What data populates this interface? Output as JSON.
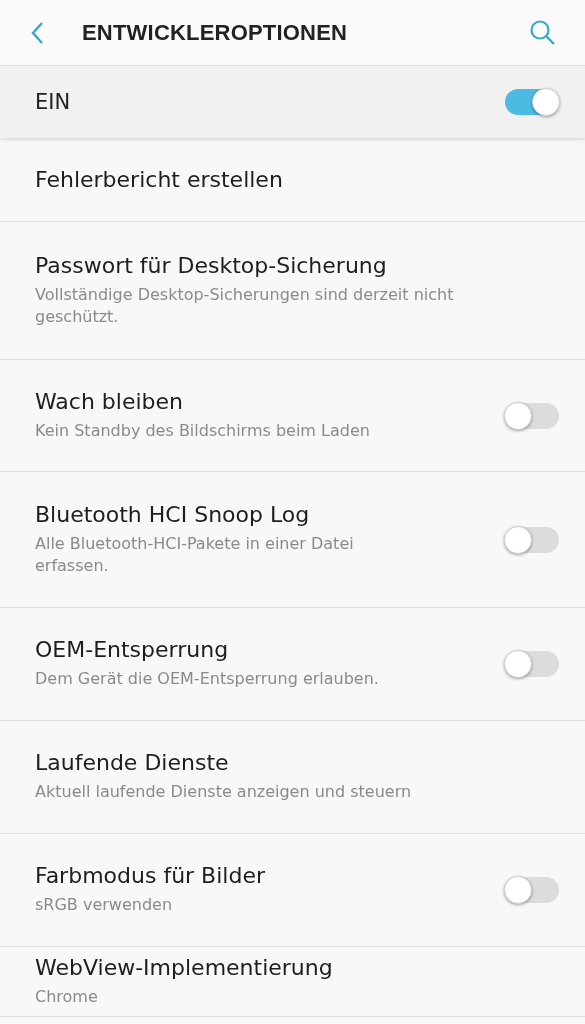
{
  "header": {
    "title": "ENTWICKLEROPTIONEN"
  },
  "master": {
    "label": "EIN",
    "on": true
  },
  "settings": [
    {
      "kind": "action",
      "title": "Fehlerbericht erstellen"
    },
    {
      "kind": "action",
      "title": "Passwort für Desktop-Sicherung",
      "summary": "Vollständige Desktop-Sicherungen sind derzeit nicht geschützt."
    },
    {
      "kind": "switch",
      "title": "Wach bleiben",
      "summary": "Kein Standby des Bildschirms beim Laden",
      "on": false
    },
    {
      "kind": "switch",
      "title": "Bluetooth HCI Snoop Log",
      "summary": "Alle Bluetooth-HCI-Pakete in einer Datei erfassen.",
      "on": false
    },
    {
      "kind": "switch",
      "title": "OEM-Entsperrung",
      "summary": "Dem Gerät die OEM-Entsperrung erlauben.",
      "on": false
    },
    {
      "kind": "action",
      "title": "Laufende Dienste",
      "summary": "Aktuell laufende Dienste anzeigen und steuern"
    },
    {
      "kind": "switch",
      "title": "Farbmodus für Bilder",
      "summary": "sRGB verwenden",
      "on": false
    },
    {
      "kind": "action",
      "title": "WebView-Implementierung",
      "summary": "Chrome"
    }
  ]
}
